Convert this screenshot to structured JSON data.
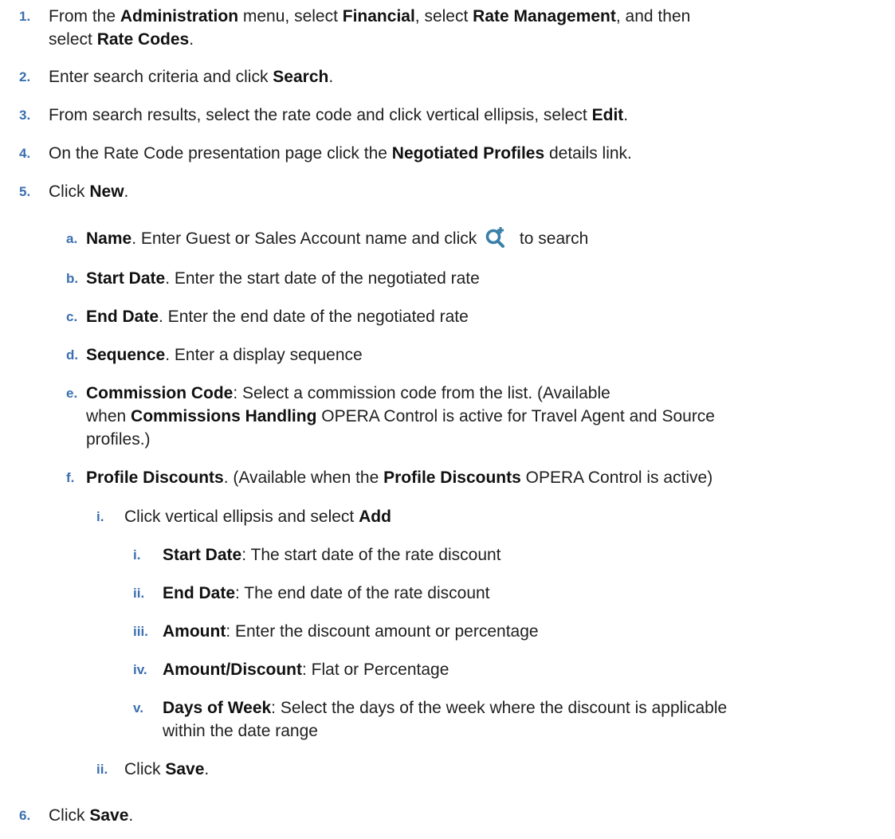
{
  "steps": [
    {
      "num": "1.",
      "parts": [
        "From the ",
        "Administration",
        " menu, select ",
        "Financial",
        ", select ",
        "Rate Management",
        ", and then"
      ],
      "line2": [
        "select ",
        "Rate Codes",
        "."
      ]
    },
    {
      "num": "2.",
      "a": "Enter search criteria and click ",
      "b": "Search",
      "c": "."
    },
    {
      "num": "3.",
      "a": "From search results, select the rate code and click vertical ellipsis, select ",
      "b": "Edit",
      "c": "."
    },
    {
      "num": "4.",
      "a": "On the Rate Code presentation page click the ",
      "b": "Negotiated Profiles",
      "c": " details link."
    },
    {
      "num": "5.",
      "a": "Click ",
      "b": "New",
      "c": "."
    },
    {
      "num": "6.",
      "a": "Click ",
      "b": "Save",
      "c": "."
    }
  ],
  "substeps": {
    "a": {
      "num": "a.",
      "b": "Name",
      "a": ". Enter Guest or Sales Account name and click ",
      "c": " to search"
    },
    "b": {
      "num": "b.",
      "b": "Start Date",
      "a": ". Enter the start date of the negotiated rate"
    },
    "c": {
      "num": "c.",
      "b": "End Date",
      "a": ". Enter the end date of the negotiated rate"
    },
    "d": {
      "num": "d.",
      "b": "Sequence",
      "a": ". Enter a display sequence"
    },
    "e": {
      "num": "e.",
      "b": "Commission Code",
      "a": ": Select a commission code from the list. (Available",
      "l2a": "when ",
      "l2b": "Commissions Handling",
      "l2c": " OPERA Control is active for Travel Agent and Source",
      "l3": "profiles.)"
    },
    "f": {
      "num": "f.",
      "b": "Profile Discounts",
      "a": ". (Available when the ",
      "b2": "Profile Discounts",
      "c": " OPERA Control is active)"
    }
  },
  "sub_f_items": {
    "i": {
      "num": "i.",
      "a": "Click vertical ellipsis and select ",
      "b": "Add"
    },
    "ii": {
      "num": "ii.",
      "a": "Click ",
      "b": "Save",
      "c": "."
    }
  },
  "sub_f_i_items": [
    {
      "num": "i.",
      "b": "Start Date",
      "a": ": The start date of the rate discount"
    },
    {
      "num": "ii.",
      "b": "End Date",
      "a": ": The end date of the rate discount"
    },
    {
      "num": "iii.",
      "b": "Amount",
      "a": ": Enter the discount amount or percentage"
    },
    {
      "num": "iv.",
      "b": "Amount/Discount",
      "a": ": Flat or Percentage"
    },
    {
      "num": "v.",
      "b": "Days of Week",
      "a": ": Select the days of the week where the discount is applicable",
      "l2": "within the date range"
    }
  ],
  "icons": {
    "search_add": "search-plus-icon",
    "search_add_color": "#3a7fa8"
  },
  "colors": {
    "list_number": "#3a6fb0",
    "text": "#1f1f1f"
  }
}
